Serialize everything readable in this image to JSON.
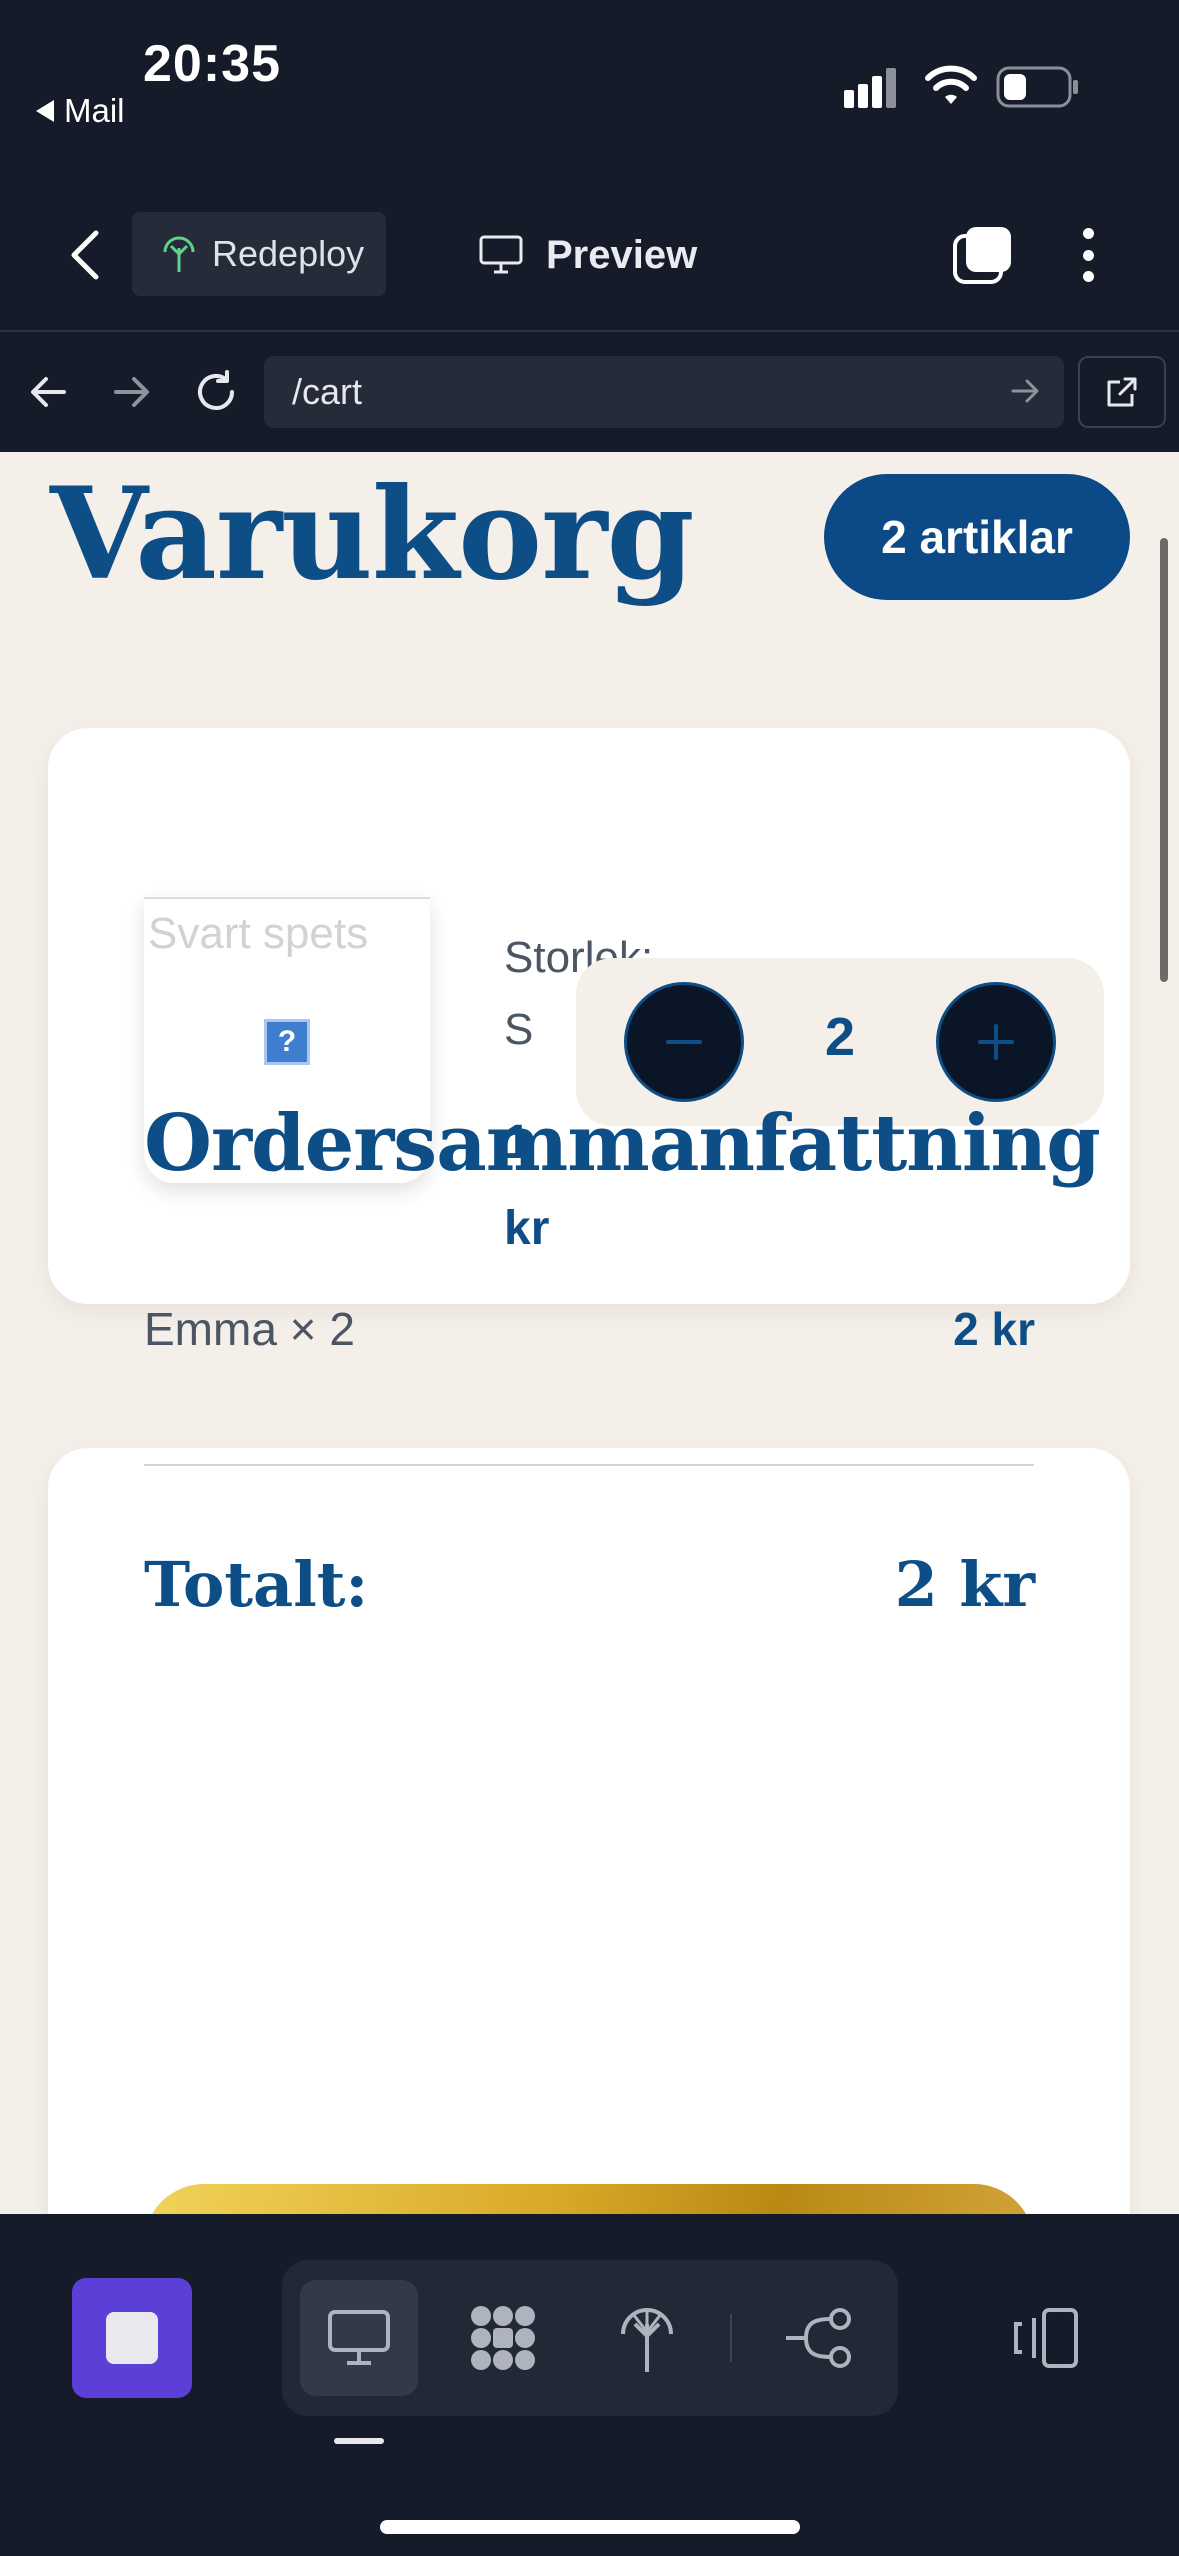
{
  "status_bar": {
    "time": "20:35",
    "back_app": "Mail"
  },
  "header": {
    "redeploy_label": "Redeploy",
    "preview_label": "Preview"
  },
  "browser": {
    "url": "/cart"
  },
  "page": {
    "title": "Varukorg",
    "item_count_badge": "2 artiklar",
    "cart_item": {
      "image_alt": "Svart spets",
      "image_placeholder_glyph": "?",
      "size_label": "Storlek:",
      "size_value": "S",
      "price_value": "1",
      "price_unit": "kr",
      "quantity": "2"
    },
    "summary": {
      "title": "Ordersammanfattning",
      "line_item": "Emma × 2",
      "line_amount": "2 kr",
      "total_label": "Totalt:",
      "total_amount": "2 kr"
    }
  },
  "colors": {
    "brand_blue": "#0e4e86",
    "page_bg": "#f4efe8",
    "chrome_bg": "#161b2a",
    "stop_purple": "#5b3fd6",
    "checkout_gold": "#d9a928"
  },
  "toolbar": {
    "icons": [
      "stop-icon",
      "desktop-icon",
      "apps-grid-icon",
      "deploy-tree-icon",
      "git-branch-icon",
      "devices-icon"
    ]
  }
}
